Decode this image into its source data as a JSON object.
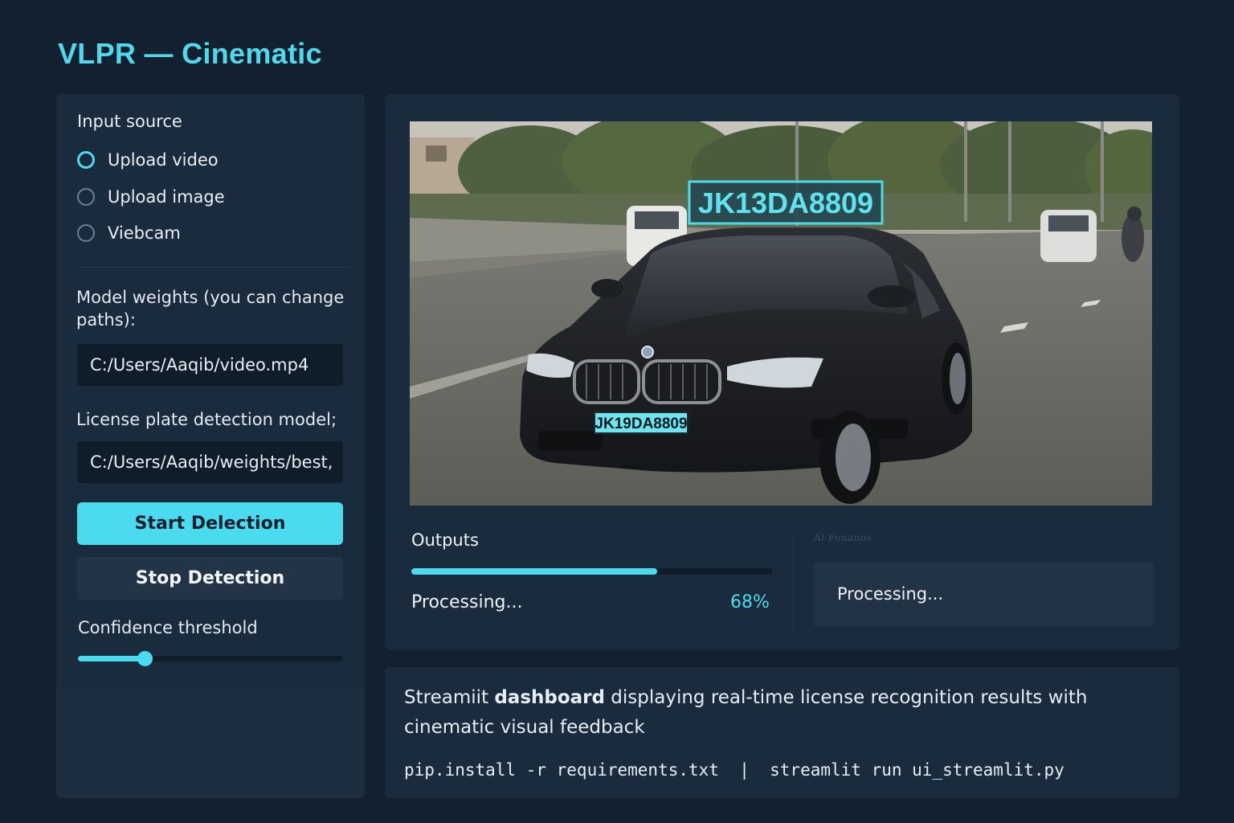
{
  "app": {
    "title": "VLPR — Cinematic"
  },
  "sidebar": {
    "input_source_heading": "Input source",
    "radio_options": [
      {
        "label": "Upload video",
        "selected": true
      },
      {
        "label": "Upload image",
        "selected": false
      },
      {
        "label": "Viebcam",
        "selected": false
      }
    ],
    "model_weights_label": "Model weights (you can change paths):",
    "model_weights_value": "C:/Users/Aaqib/video.mp4",
    "plate_model_label": "License plate detection model;",
    "plate_model_value": "C:/Users/Aaqib/weights/best,",
    "start_button": "Start Delection",
    "stop_button": "Stop Detection",
    "confidence_label": "Confidence threshold",
    "confidence_value": 0.25
  },
  "video": {
    "plate_overlay": "JK13DA8809",
    "plate_on_car": "JK19DA8809"
  },
  "outputs": {
    "title": "Outputs",
    "progress_percent": 68,
    "processing_text": "Processing...",
    "progress_label": "68%",
    "faint_label": "Al Fonanos",
    "status_text": "Processing..."
  },
  "info": {
    "desc_part1": "Streamiit ",
    "desc_bold": "dashboard",
    "desc_part2": " displaying real-time license recognition results with cinematic visual feedback",
    "command": "pip.install -r requirements.txt  |  streamlit run ui_streamlit.py"
  },
  "colors": {
    "accent": "#4adbee",
    "background": "#12202f",
    "panel": "#1a2b3d",
    "input_bg": "#0f1c2a"
  }
}
